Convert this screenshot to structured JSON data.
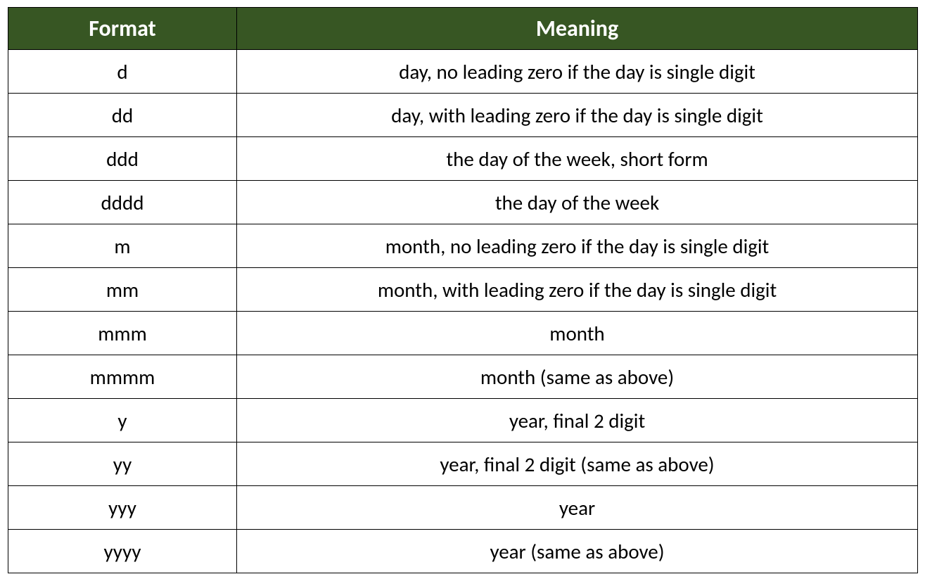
{
  "table": {
    "headers": {
      "format": "Format",
      "meaning": "Meaning"
    },
    "rows": [
      {
        "format": "d",
        "meaning": "day, no leading zero if the day is single digit"
      },
      {
        "format": "dd",
        "meaning": "day, with leading zero if the day is single digit"
      },
      {
        "format": "ddd",
        "meaning": "the day of the week, short form"
      },
      {
        "format": "dddd",
        "meaning": "the day of the week"
      },
      {
        "format": "m",
        "meaning": "month, no leading zero if the day is single digit"
      },
      {
        "format": "mm",
        "meaning": "month, with leading zero if the day is single digit"
      },
      {
        "format": "mmm",
        "meaning": "month"
      },
      {
        "format": "mmmm",
        "meaning": "month (same as above)"
      },
      {
        "format": "y",
        "meaning": "year, final 2 digit"
      },
      {
        "format": "yy",
        "meaning": "year, final 2 digit (same as above)"
      },
      {
        "format": "yyy",
        "meaning": "year"
      },
      {
        "format": "yyyy",
        "meaning": "year (same as above)"
      }
    ]
  },
  "chart_data": {
    "type": "table",
    "columns": [
      "Format",
      "Meaning"
    ],
    "rows": [
      [
        "d",
        "day, no leading zero if the day is single digit"
      ],
      [
        "dd",
        "day, with leading zero if the day is single digit"
      ],
      [
        "ddd",
        "the day of the week, short form"
      ],
      [
        "dddd",
        "the day of the week"
      ],
      [
        "m",
        "month, no leading zero if the day is single digit"
      ],
      [
        "mm",
        "month, with leading zero if the day is single digit"
      ],
      [
        "mmm",
        "month"
      ],
      [
        "mmmm",
        "month (same as above)"
      ],
      [
        "y",
        "year, final 2 digit"
      ],
      [
        "yy",
        "year, final 2 digit (same as above)"
      ],
      [
        "yyy",
        "year"
      ],
      [
        "yyyy",
        "year (same as above)"
      ]
    ]
  }
}
